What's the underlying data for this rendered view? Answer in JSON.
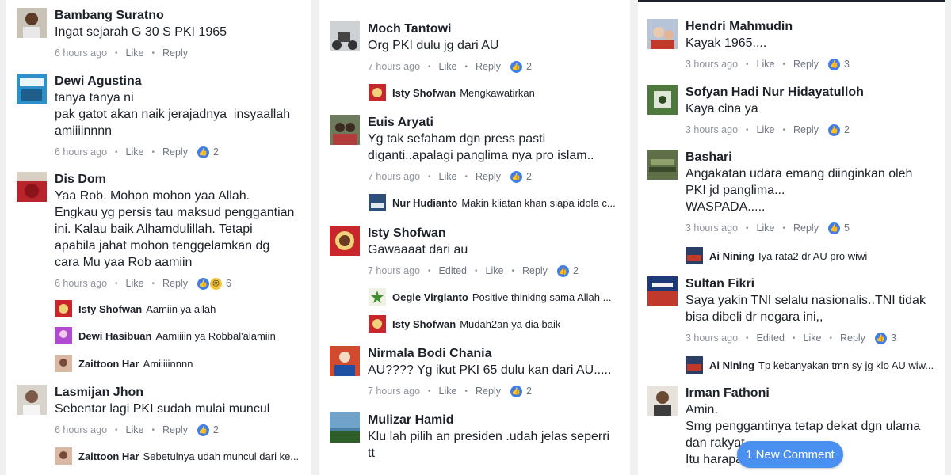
{
  "ui": {
    "like": "Like",
    "reply": "Reply",
    "edited": "Edited",
    "new_comment_pill": "1 New Comment"
  },
  "col1": {
    "c1": {
      "name": "Bambang Suratno",
      "text": "Ingat sejarah G 30 S PKI 1965",
      "time": "6 hours ago"
    },
    "c2": {
      "name": "Dewi Agustina",
      "text": "tanya tanya ni\npak gatot akan naik jerajadnya  insyaallah\namiiiinnnn",
      "time": "6 hours ago",
      "reactions": "2"
    },
    "c3": {
      "name": "Dis Dom",
      "text": "Yaa Rob. Mohon mohon yaa Allah.\nEngkau yg persis tau maksud penggantian\nini. Kalau baik Alhamdulillah. Tetapi\napabila jahat mohon tenggelamkan dg\ncara Mu yaa Rob aamiin",
      "time": "6 hours ago",
      "reactions": "6"
    },
    "r1": {
      "name": "Isty Shofwan",
      "text": "Aamiin ya allah"
    },
    "r2": {
      "name": "Dewi Hasibuan",
      "text": "Aamiiiin ya Robbal'alamiin"
    },
    "r3": {
      "name": "Zaittoon Har",
      "text": "Amiiiiinnnn"
    },
    "c4": {
      "name": "Lasmijan Jhon",
      "text": "Sebentar lagi PKI sudah mulai muncul",
      "time": "6 hours ago",
      "reactions": "2"
    },
    "r4": {
      "name": "Zaittoon Har",
      "text": "Sebetulnya  udah muncul dari ke..."
    }
  },
  "col2": {
    "c1": {
      "name": "Moch Tantowi",
      "text": "Org PKI dulu jg dari AU",
      "time": "7 hours ago",
      "reactions": "2"
    },
    "r1": {
      "name": "Isty Shofwan",
      "text": "Mengkawatirkan"
    },
    "c2": {
      "name": "Euis Aryati",
      "text": "Yg tak sefaham dgn press pasti\ndiganti..apalagi panglima nya pro islam..",
      "time": "7 hours ago",
      "reactions": "2"
    },
    "r2": {
      "name": "Nur Hudianto",
      "text": "Makin kliatan khan siapa idola c..."
    },
    "c3": {
      "name": "Isty Shofwan",
      "text": "Gawaaaat dari au",
      "time": "7 hours ago",
      "reactions": "2"
    },
    "r3": {
      "name": "Oegie Virgianto",
      "text": "Positive thinking sama Allah ..."
    },
    "r4": {
      "name": "Isty Shofwan",
      "text": "Mudah2an ya dia baik"
    },
    "c4": {
      "name": "Nirmala Bodi Chania",
      "text": "AU???? Yg ikut PKI 65 dulu kan dari AU.....",
      "time": "7 hours ago",
      "reactions": "2"
    },
    "c5": {
      "name": "Mulizar Hamid",
      "text": "Klu lah pilih an presiden .udah jelas seperri\ntt"
    }
  },
  "col3": {
    "c1": {
      "name": "Hendri Mahmudin",
      "text": "Kayak 1965....",
      "time": "3 hours ago",
      "reactions": "3"
    },
    "c2": {
      "name": "Sofyan Hadi Nur Hidayatulloh",
      "text": "Kaya cina ya",
      "time": "3 hours ago",
      "reactions": "2"
    },
    "c3": {
      "name": "Bashari",
      "text": "Angakatan udara emang diinginkan oleh\nPKI jd panglima...\nWASPADA.....",
      "time": "3 hours ago",
      "reactions": "5"
    },
    "r1": {
      "name": "Ai Nining",
      "text": "Iya rata2 dr AU pro wiwi"
    },
    "c4": {
      "name": "Sultan Fikri",
      "text": "Saya yakin TNI selalu nasionalis..TNI tidak\nbisa dibeli dr negara ini,,",
      "time": "3 hours ago",
      "reactions": "3"
    },
    "r2": {
      "name": "Ai Nining",
      "text": "Tp kebanyakan tmn sy jg klo AU wiw..."
    },
    "c5": {
      "name": "Irman Fathoni",
      "text": "Amin.\nSmg penggantinya tetap dekat dgn ulama\ndan rakyat\nItu harapan"
    }
  }
}
